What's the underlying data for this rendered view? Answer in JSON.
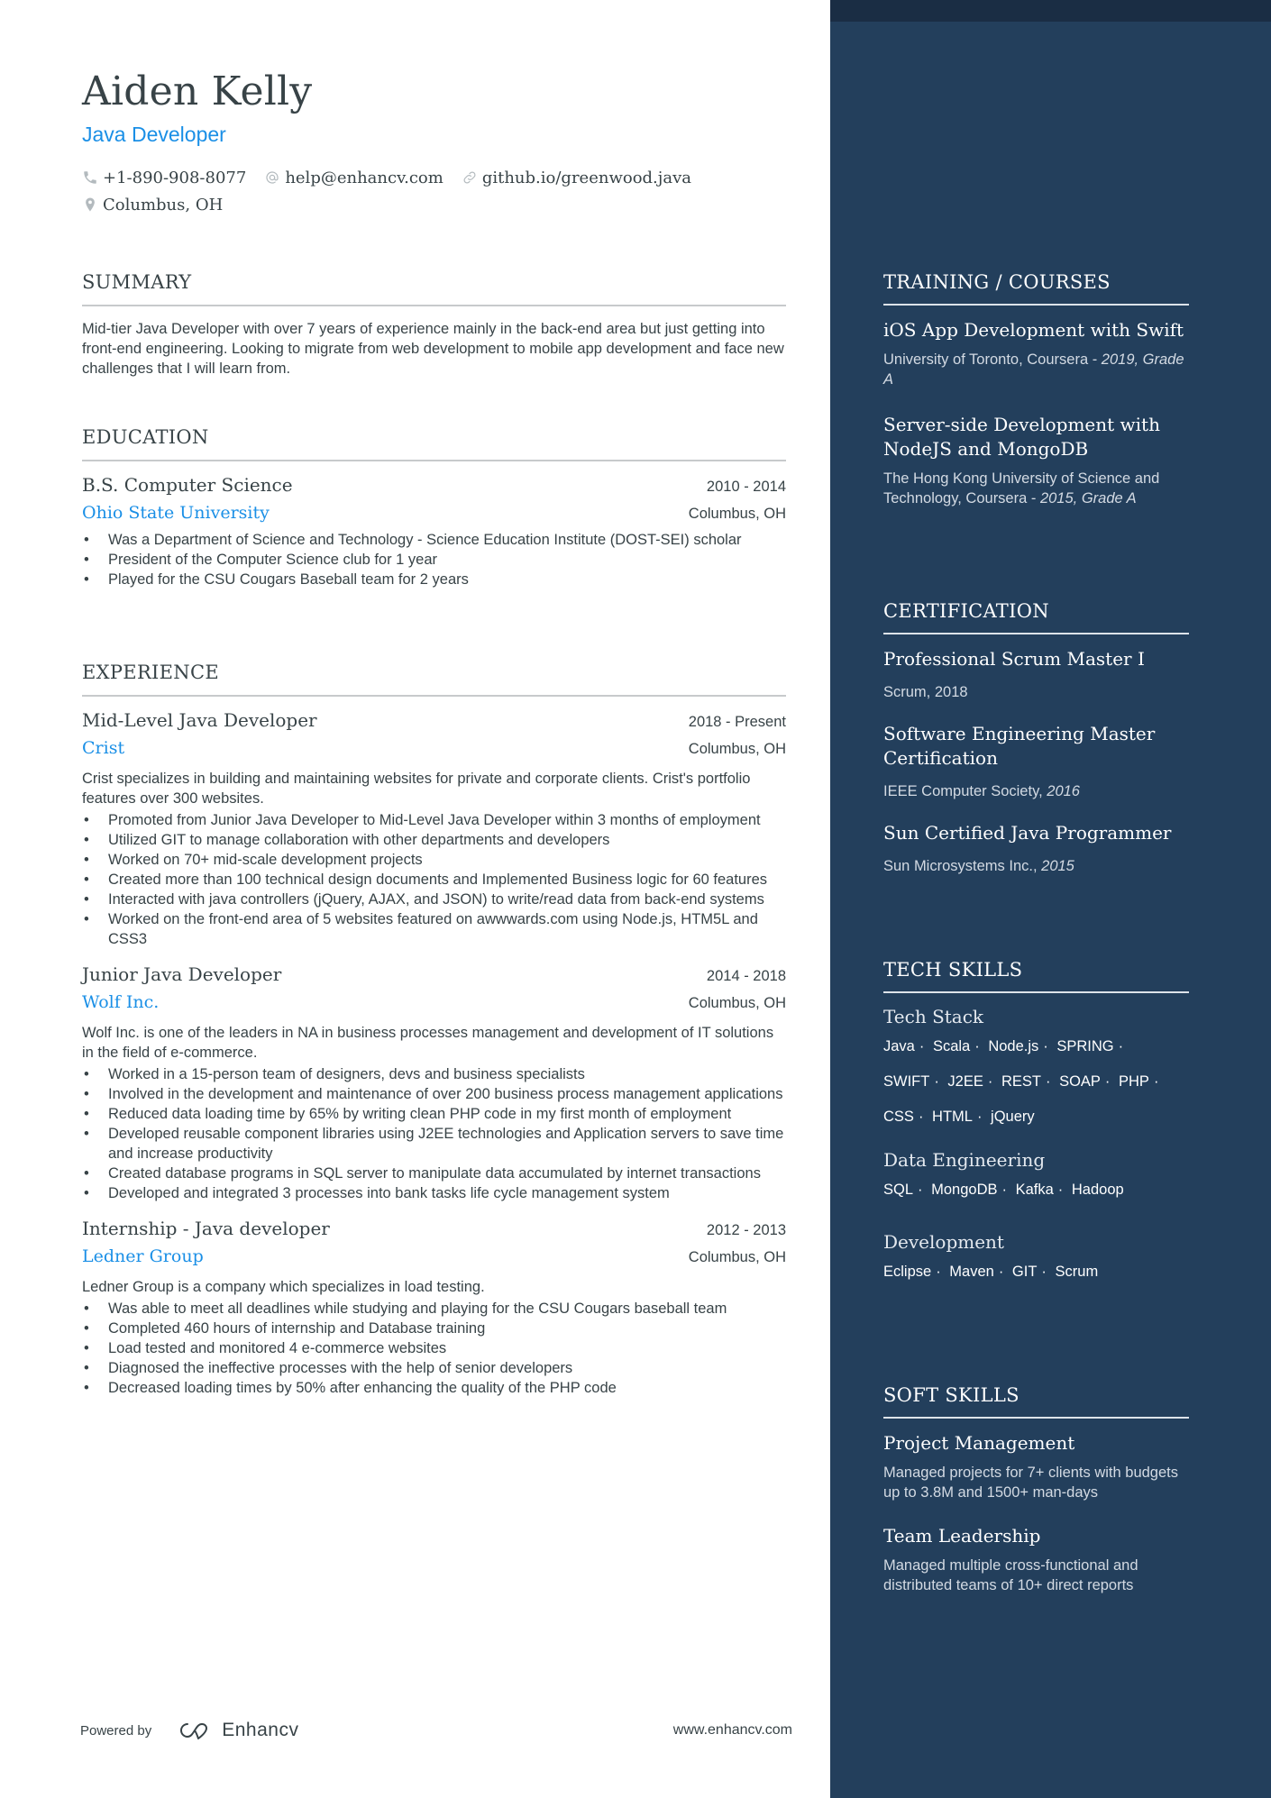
{
  "header": {
    "name": "Aiden Kelly",
    "title": "Java Developer",
    "contacts": {
      "phone": "+1-890-908-8077",
      "email": "help@enhancv.com",
      "link": "github.io/greenwood.java",
      "location": "Columbus, OH"
    }
  },
  "summary": {
    "heading": "SUMMARY",
    "text": "Mid-tier Java Developer with over 7 years of experience mainly in the back-end area but just getting into front-end engineering. Looking to migrate from web development to mobile app development and face new challenges that I will learn from."
  },
  "education": {
    "heading": "EDUCATION",
    "items": [
      {
        "degree": "B.S. Computer Science",
        "dates": "2010 - 2014",
        "school": "Ohio State University",
        "location": "Columbus, OH",
        "bullets": [
          "Was a Department of Science and Technology - Science Education Institute (DOST-SEI) scholar",
          "President of the Computer Science club for 1 year",
          "Played for the CSU Cougars Baseball team for 2 years"
        ]
      }
    ]
  },
  "experience": {
    "heading": "EXPERIENCE",
    "items": [
      {
        "role": "Mid-Level Java Developer",
        "dates": "2018 - Present",
        "company": "Crist",
        "location": "Columbus, OH",
        "description": "Crist specializes in building and maintaining websites for private and corporate clients. Crist's portfolio features over 300 websites.",
        "bullets": [
          "Promoted from Junior Java Developer to Mid-Level Java Developer within 3 months of employment",
          "Utilized GIT to manage collaboration with other departments and developers",
          "Worked on 70+ mid-scale development projects",
          "Created more than 100 technical design documents and Implemented Business logic for 60 features",
          "Interacted with java controllers (jQuery, AJAX, and JSON) to write/read data from back-end systems",
          "Worked on the front-end area of 5 websites featured on awwwards.com using Node.js, HTM5L and CSS3"
        ]
      },
      {
        "role": "Junior Java Developer",
        "dates": "2014 - 2018",
        "company": "Wolf Inc.",
        "location": "Columbus, OH",
        "description": "Wolf Inc. is one of the leaders in NA in business processes management and development of IT solutions in the field of e-commerce.",
        "bullets": [
          "Worked in a 15-person team of designers, devs and business specialists",
          "Involved in the development and maintenance of over 200 business process management applications",
          "Reduced data loading time by 65% by writing clean PHP code in my first month of employment",
          "Developed reusable component libraries using J2EE technologies and Application servers to save time and increase productivity",
          "Created database programs in SQL server to manipulate data accumulated by internet transactions",
          "Developed and integrated 3 processes into bank tasks life cycle management system"
        ]
      },
      {
        "role": "Internship - Java developer",
        "dates": "2012 - 2013",
        "company": "Ledner Group",
        "location": "Columbus, OH",
        "description": "Ledner Group is a company which specializes in load testing.",
        "bullets": [
          "Was able to meet all deadlines while studying and playing for the CSU Cougars baseball team",
          "Completed 460 hours of internship and Database training",
          "Load tested and monitored 4 e-commerce websites",
          "Diagnosed the ineffective processes with the help of senior developers",
          "Decreased loading times by 50% after enhancing the quality of the PHP code"
        ]
      }
    ]
  },
  "footer": {
    "powered_by": "Powered by",
    "brand": "Enhancv",
    "website": "www.enhancv.com"
  },
  "training": {
    "heading": "TRAINING / COURSES",
    "items": [
      {
        "title": "iOS App Development with Swift",
        "provider": "University of Toronto, Coursera - ",
        "detail": "2019, Grade A"
      },
      {
        "title": "Server-side Development with NodeJS and MongoDB",
        "provider": "The Hong Kong University of Science and Technology, Coursera - ",
        "detail": "2015, Grade A"
      }
    ]
  },
  "certification": {
    "heading": "CERTIFICATION",
    "items": [
      {
        "title": "Professional Scrum Master I",
        "issuer": "Scrum, 2018",
        "year": ""
      },
      {
        "title": "Software Engineering Master Certification",
        "issuer": "IEEE Computer Society, ",
        "year": "2016"
      },
      {
        "title": "Sun Certified Java Programmer",
        "issuer": "Sun Microsystems Inc., ",
        "year": "2015"
      }
    ]
  },
  "tech_skills": {
    "heading": "TECH SKILLS",
    "groups": [
      {
        "name": "Tech Stack",
        "skills": [
          "Java",
          "Scala",
          "Node.js",
          "SPRING",
          "SWIFT",
          "J2EE",
          "REST",
          "SOAP",
          "PHP",
          "CSS",
          "HTML",
          "jQuery"
        ]
      },
      {
        "name": "Data Engineering",
        "skills": [
          "SQL",
          "MongoDB",
          "Kafka",
          "Hadoop"
        ]
      },
      {
        "name": "Development",
        "skills": [
          "Eclipse",
          "Maven",
          "GIT",
          "Scrum"
        ]
      }
    ]
  },
  "soft_skills": {
    "heading": "SOFT SKILLS",
    "items": [
      {
        "title": "Project Management",
        "description": "Managed projects for 7+ clients with budgets up to 3.8M and 1500+ man-days"
      },
      {
        "title": "Team Leadership",
        "description": "Managed multiple cross-functional and distributed teams of 10+ direct reports"
      }
    ]
  },
  "colors": {
    "accent": "#1a8fe6",
    "text": "#384347",
    "sidebar_bg": "#233f5c",
    "sidebar_top": "#1a2d44"
  }
}
